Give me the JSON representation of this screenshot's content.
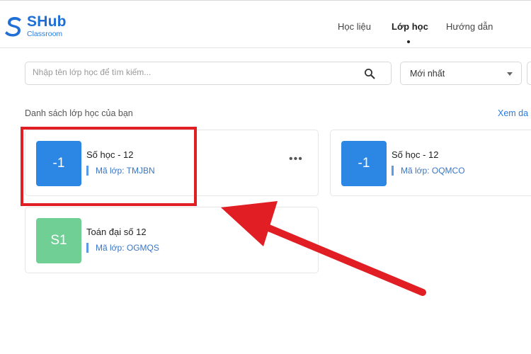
{
  "header": {
    "brand": "SHub",
    "brand_sub": "Classroom",
    "nav": [
      {
        "label": "Học liệu"
      },
      {
        "label": "Lớp học"
      },
      {
        "label": "Hướng dẫn"
      }
    ],
    "active_nav": "Lớp học"
  },
  "search": {
    "placeholder": "Nhập tên lớp học để tìm kiếm...",
    "value": ""
  },
  "sort": {
    "selected": "Mới nhất"
  },
  "section": {
    "title": "Danh sách lớp học của bạn",
    "view_all": "Xem da"
  },
  "classes": [
    {
      "thumb": "-1",
      "name": "Số học - 12",
      "code": "Mã lớp: TMJBN",
      "color": "#2b87e3"
    },
    {
      "thumb": "-1",
      "name": "Số học - 12",
      "code": "Mã lớp: OQMCO",
      "color": "#2b87e3"
    },
    {
      "thumb": "S1",
      "name": "Toán đại số 12",
      "code": "Mã lớp: OGMQS",
      "color": "#70cf95"
    }
  ],
  "annotation": {
    "box_color": "#e01e24",
    "arrow_color": "#e01e24"
  },
  "icons": {
    "logo": "shub-logo-icon",
    "search": "search-icon",
    "sort": "chevron-down-icon",
    "menu": "more-options-icon"
  }
}
